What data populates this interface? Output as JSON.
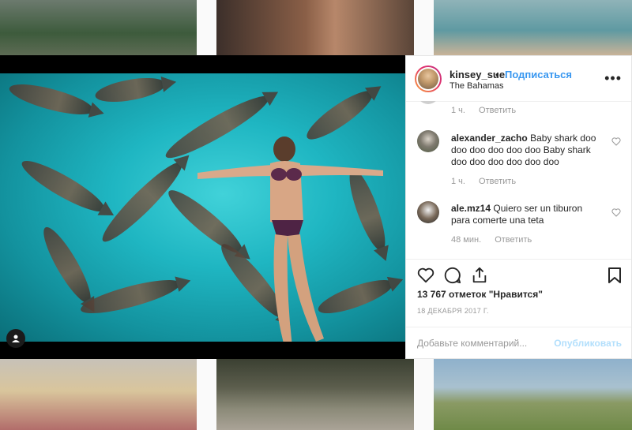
{
  "post": {
    "username": "kinsey_sue",
    "separator": "•",
    "follow_label": "Подписаться",
    "location": "The Bahamas",
    "more_label": "•••"
  },
  "comments": [
    {
      "time": "1 ч.",
      "reply": "Ответить"
    },
    {
      "username": "alexander_zacho",
      "text": "Baby shark doo doo doo doo doo doo Baby shark doo doo doo doo doo doo",
      "time": "1 ч.",
      "reply": "Ответить"
    },
    {
      "username": "ale.mz14",
      "text": "Quiero ser un tiburon para comerte una teta",
      "time": "48 мин.",
      "reply": "Ответить"
    }
  ],
  "likes_text": "13 767 отметок \"Нравится\"",
  "date_text": "18 ДЕКАБРЯ 2017 Г.",
  "add_comment": {
    "placeholder": "Добавьте комментарий...",
    "publish_label": "Опубликовать"
  },
  "colors": {
    "accent": "#3897f0",
    "publish_disabled": "#b2dffc",
    "text": "#262626",
    "muted": "#999999"
  },
  "icons": [
    "heart-icon",
    "comment-icon",
    "share-icon",
    "bookmark-icon",
    "more-icon",
    "user-tag-icon"
  ]
}
